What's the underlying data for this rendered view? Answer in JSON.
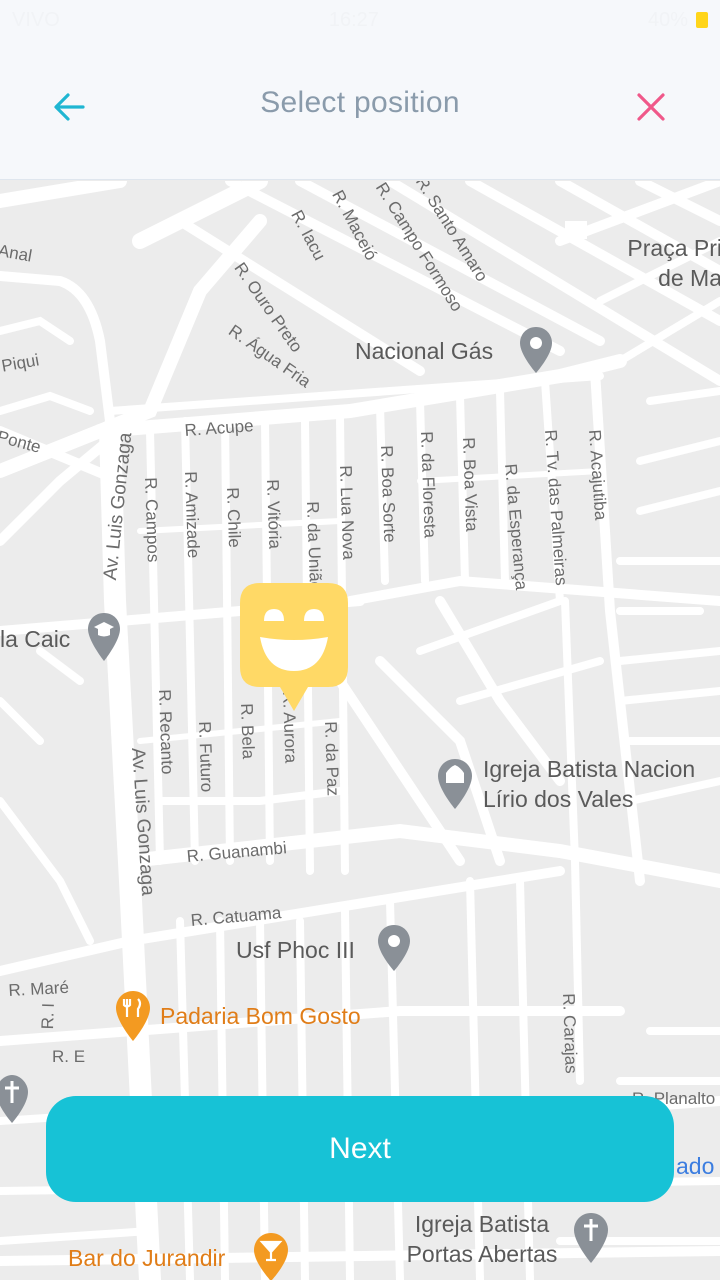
{
  "status_bar": {
    "carrier": "VIVO",
    "time": "16:27",
    "battery": "40%"
  },
  "header": {
    "title": "Select position"
  },
  "map": {
    "road_labels": [
      "R. Iacu",
      "R. Maceió",
      "R. Campo Formoso",
      "R. Santo Amaro",
      "R. Ouro Preto",
      "R. Água Fria",
      "R. Acupe",
      "Av. Luis Gonzaga",
      "R. Campos",
      "R. Amizade",
      "R. Chile",
      "R. Vitória",
      "R. da União",
      "R. Lua Nova",
      "R. Boa Sorte",
      "R. da Floresta",
      "R. Boa Vista",
      "R. da Esperança",
      "R. Tv. das Palmeiras",
      "R. Acajutiba",
      "R. Recanto",
      "R. Futuro",
      "R. Bela",
      "R. Aurora",
      "R. da Paz",
      "Av. Luis Gonzaga",
      "R. Guanambi",
      "R. Catuama",
      "R. Maré",
      "R. E",
      "R. I",
      "R. Carajas",
      "R. Planalto",
      "Anal",
      "Piqui",
      "Ponte"
    ],
    "pois": [
      {
        "name_line1": "Praça Pri",
        "name_line2": "de Ma"
      },
      {
        "name_line1": "Nacional Gás"
      },
      {
        "name_line1": "la Caic"
      },
      {
        "name_line1": "Igreja Batista Nacion",
        "name_line2": "Lírio dos Vales"
      },
      {
        "name_line1": "Usf Phoc III"
      },
      {
        "name_line1": "Padaria Bom Gosto"
      },
      {
        "name_line1": "Igreja Batista",
        "name_line2": "Portas Abertas"
      },
      {
        "name_line1": "Bar do Jurandir"
      },
      {
        "name_line1": "ado"
      }
    ],
    "marker_icon": "smiley-marker-icon"
  },
  "footer": {
    "next_label": "Next"
  },
  "colors": {
    "accent": "#17c2d6",
    "back_arrow": "#1fb6d2",
    "close_x": "#f0588a",
    "marker": "#ffd966"
  }
}
